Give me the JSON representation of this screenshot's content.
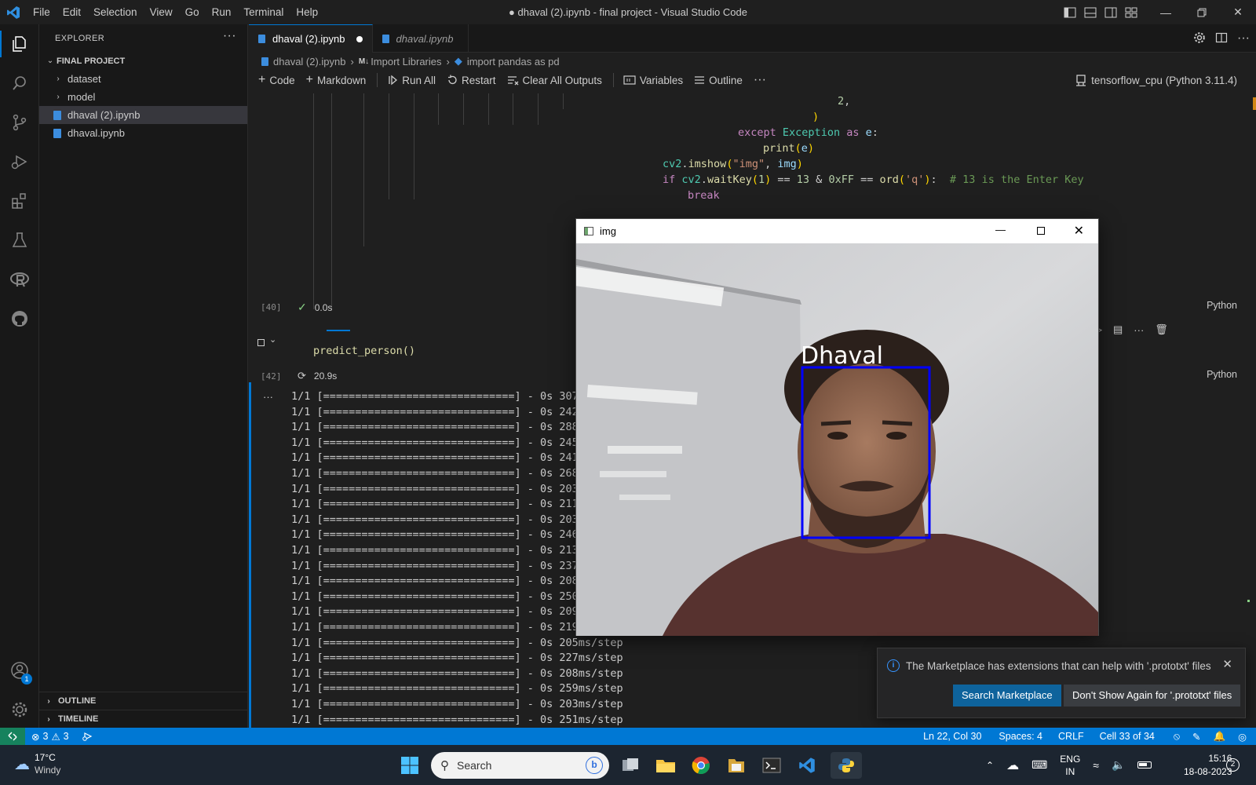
{
  "window": {
    "title": "● dhaval (2).ipynb - final project - Visual Studio Code",
    "menu": [
      "File",
      "Edit",
      "Selection",
      "View",
      "Go",
      "Run",
      "Terminal",
      "Help"
    ]
  },
  "sidebar": {
    "header": "EXPLORER",
    "folder": "FINAL PROJECT",
    "items": [
      {
        "label": "dataset",
        "type": "folder"
      },
      {
        "label": "model",
        "type": "folder"
      },
      {
        "label": "dhaval (2).ipynb",
        "type": "file",
        "selected": true
      },
      {
        "label": "dhaval.ipynb",
        "type": "file",
        "selected": false
      }
    ],
    "outline": "OUTLINE",
    "timeline": "TIMELINE",
    "accounts_badge": "1"
  },
  "tabs": [
    {
      "label": "dhaval (2).ipynb",
      "active": true,
      "dirty": true
    },
    {
      "label": "dhaval.ipynb",
      "active": false,
      "dirty": false
    }
  ],
  "breadcrumb": {
    "file": "dhaval (2).ipynb",
    "section_prefix": "M↓",
    "section": "Import Libraries",
    "symbol": "import pandas as pd"
  },
  "notebook_toolbar": {
    "code": "Code",
    "markdown": "Markdown",
    "run_all": "Run All",
    "restart": "Restart",
    "clear": "Clear All Outputs",
    "variables": "Variables",
    "outline": "Outline",
    "kernel": "tensorflow_cpu (Python 3.11.4)"
  },
  "cell1": {
    "exec_count": "[40]",
    "status_time": "0.0s",
    "language": "Python"
  },
  "cell2": {
    "code": "predict_person()",
    "exec_count": "[42]",
    "status_time": "20.9s",
    "language": "Python"
  },
  "output": {
    "step_prefix": "1/1",
    "bar": "[==============================]",
    "lines": [
      "- 0s 307ms/step",
      "- 0s 242ms/step",
      "- 0s 288ms/step",
      "- 0s 245ms/step",
      "- 0s 241ms/step",
      "- 0s 268ms/step",
      "- 0s 203ms/step",
      "- 0s 211ms/step",
      "- 0s 203ms/step",
      "- 0s 246ms/step",
      "- 0s 213ms/step",
      "- 0s 237ms/step",
      "- 0s 208ms/step",
      "- 0s 250ms/step",
      "- 0s 209ms/step",
      "- 0s 219ms/step",
      "- 0s 205ms/step",
      "- 0s 227ms/step",
      "- 0s 208ms/step",
      "- 0s 259ms/step",
      "- 0s 203ms/step",
      "- 0s 251ms/step"
    ]
  },
  "img_window": {
    "title": "img",
    "label": "Dhaval"
  },
  "notification": {
    "message": "The Marketplace has extensions that can help with '.prototxt' files",
    "primary": "Search Marketplace",
    "secondary": "Don't Show Again for '.prototxt' files"
  },
  "statusbar": {
    "errors": "3",
    "warnings": "3",
    "position": "Ln 22, Col 30",
    "spaces": "Spaces: 4",
    "eol": "CRLF",
    "cell": "Cell 33 of 34"
  },
  "taskbar": {
    "weather_temp": "17°C",
    "weather_desc": "Windy",
    "search": "Search",
    "lang1": "ENG",
    "lang2": "IN",
    "time": "15:16",
    "date": "18-08-2023",
    "notif_count": "2"
  },
  "colors": {
    "accent": "#0078d4",
    "statusbar": "#0078d4",
    "button": "#0e639c",
    "face_box": "#0000ff"
  }
}
